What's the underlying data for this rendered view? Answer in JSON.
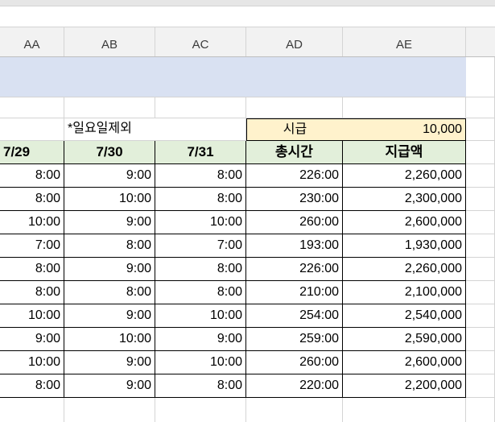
{
  "columns": [
    "AA",
    "AB",
    "AC",
    "AD",
    "AE"
  ],
  "note": "*일요일제외",
  "rate": {
    "label": "시급",
    "value": "10,000"
  },
  "headers": [
    "7/29",
    "7/30",
    "7/31",
    "총시간",
    "지급액"
  ],
  "rows": [
    [
      "8:00",
      "9:00",
      "8:00",
      "226:00",
      "2,260,000"
    ],
    [
      "8:00",
      "10:00",
      "8:00",
      "230:00",
      "2,300,000"
    ],
    [
      "10:00",
      "9:00",
      "10:00",
      "260:00",
      "2,600,000"
    ],
    [
      "7:00",
      "8:00",
      "7:00",
      "193:00",
      "1,930,000"
    ],
    [
      "8:00",
      "9:00",
      "8:00",
      "226:00",
      "2,260,000"
    ],
    [
      "8:00",
      "8:00",
      "8:00",
      "210:00",
      "2,100,000"
    ],
    [
      "10:00",
      "9:00",
      "10:00",
      "254:00",
      "2,540,000"
    ],
    [
      "9:00",
      "10:00",
      "9:00",
      "259:00",
      "2,590,000"
    ],
    [
      "10:00",
      "9:00",
      "10:00",
      "260:00",
      "2,600,000"
    ],
    [
      "8:00",
      "9:00",
      "8:00",
      "220:00",
      "2,200,000"
    ]
  ],
  "colors": {
    "band": "#d9e1f2",
    "header_fill": "#e2efda",
    "rate_fill": "#fff2cc"
  }
}
